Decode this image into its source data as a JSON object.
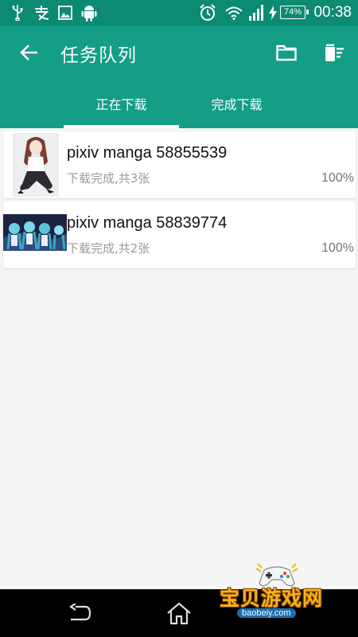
{
  "status_bar": {
    "battery": "74%",
    "time": "00:38",
    "icons": [
      "usb-icon",
      "alipay-icon",
      "image-icon",
      "android-icon",
      "alarm-icon",
      "wifi-icon",
      "signal-icon",
      "charging-icon"
    ]
  },
  "app_bar": {
    "title": "任务队列",
    "back_icon": "arrow-left-icon",
    "folder_icon": "folder-icon",
    "delete_icon": "delete-list-icon",
    "background": "#139e85",
    "status_background": "#0c8a72"
  },
  "tabs": [
    {
      "label": "正在下载",
      "active": true
    },
    {
      "label": "完成下载",
      "active": false
    }
  ],
  "tasks": [
    {
      "title": "pixiv manga 58855539",
      "status": "下载完成,共3张",
      "progress": "100%"
    },
    {
      "title": "pixiv manga 58839774",
      "status": "下载完成,共2张",
      "progress": "100%"
    }
  ],
  "nav_bar": {
    "back_icon": "nav-back-icon",
    "home_icon": "home-icon"
  },
  "watermark": {
    "text": "宝贝游戏网",
    "url": "baobeiy.com"
  }
}
